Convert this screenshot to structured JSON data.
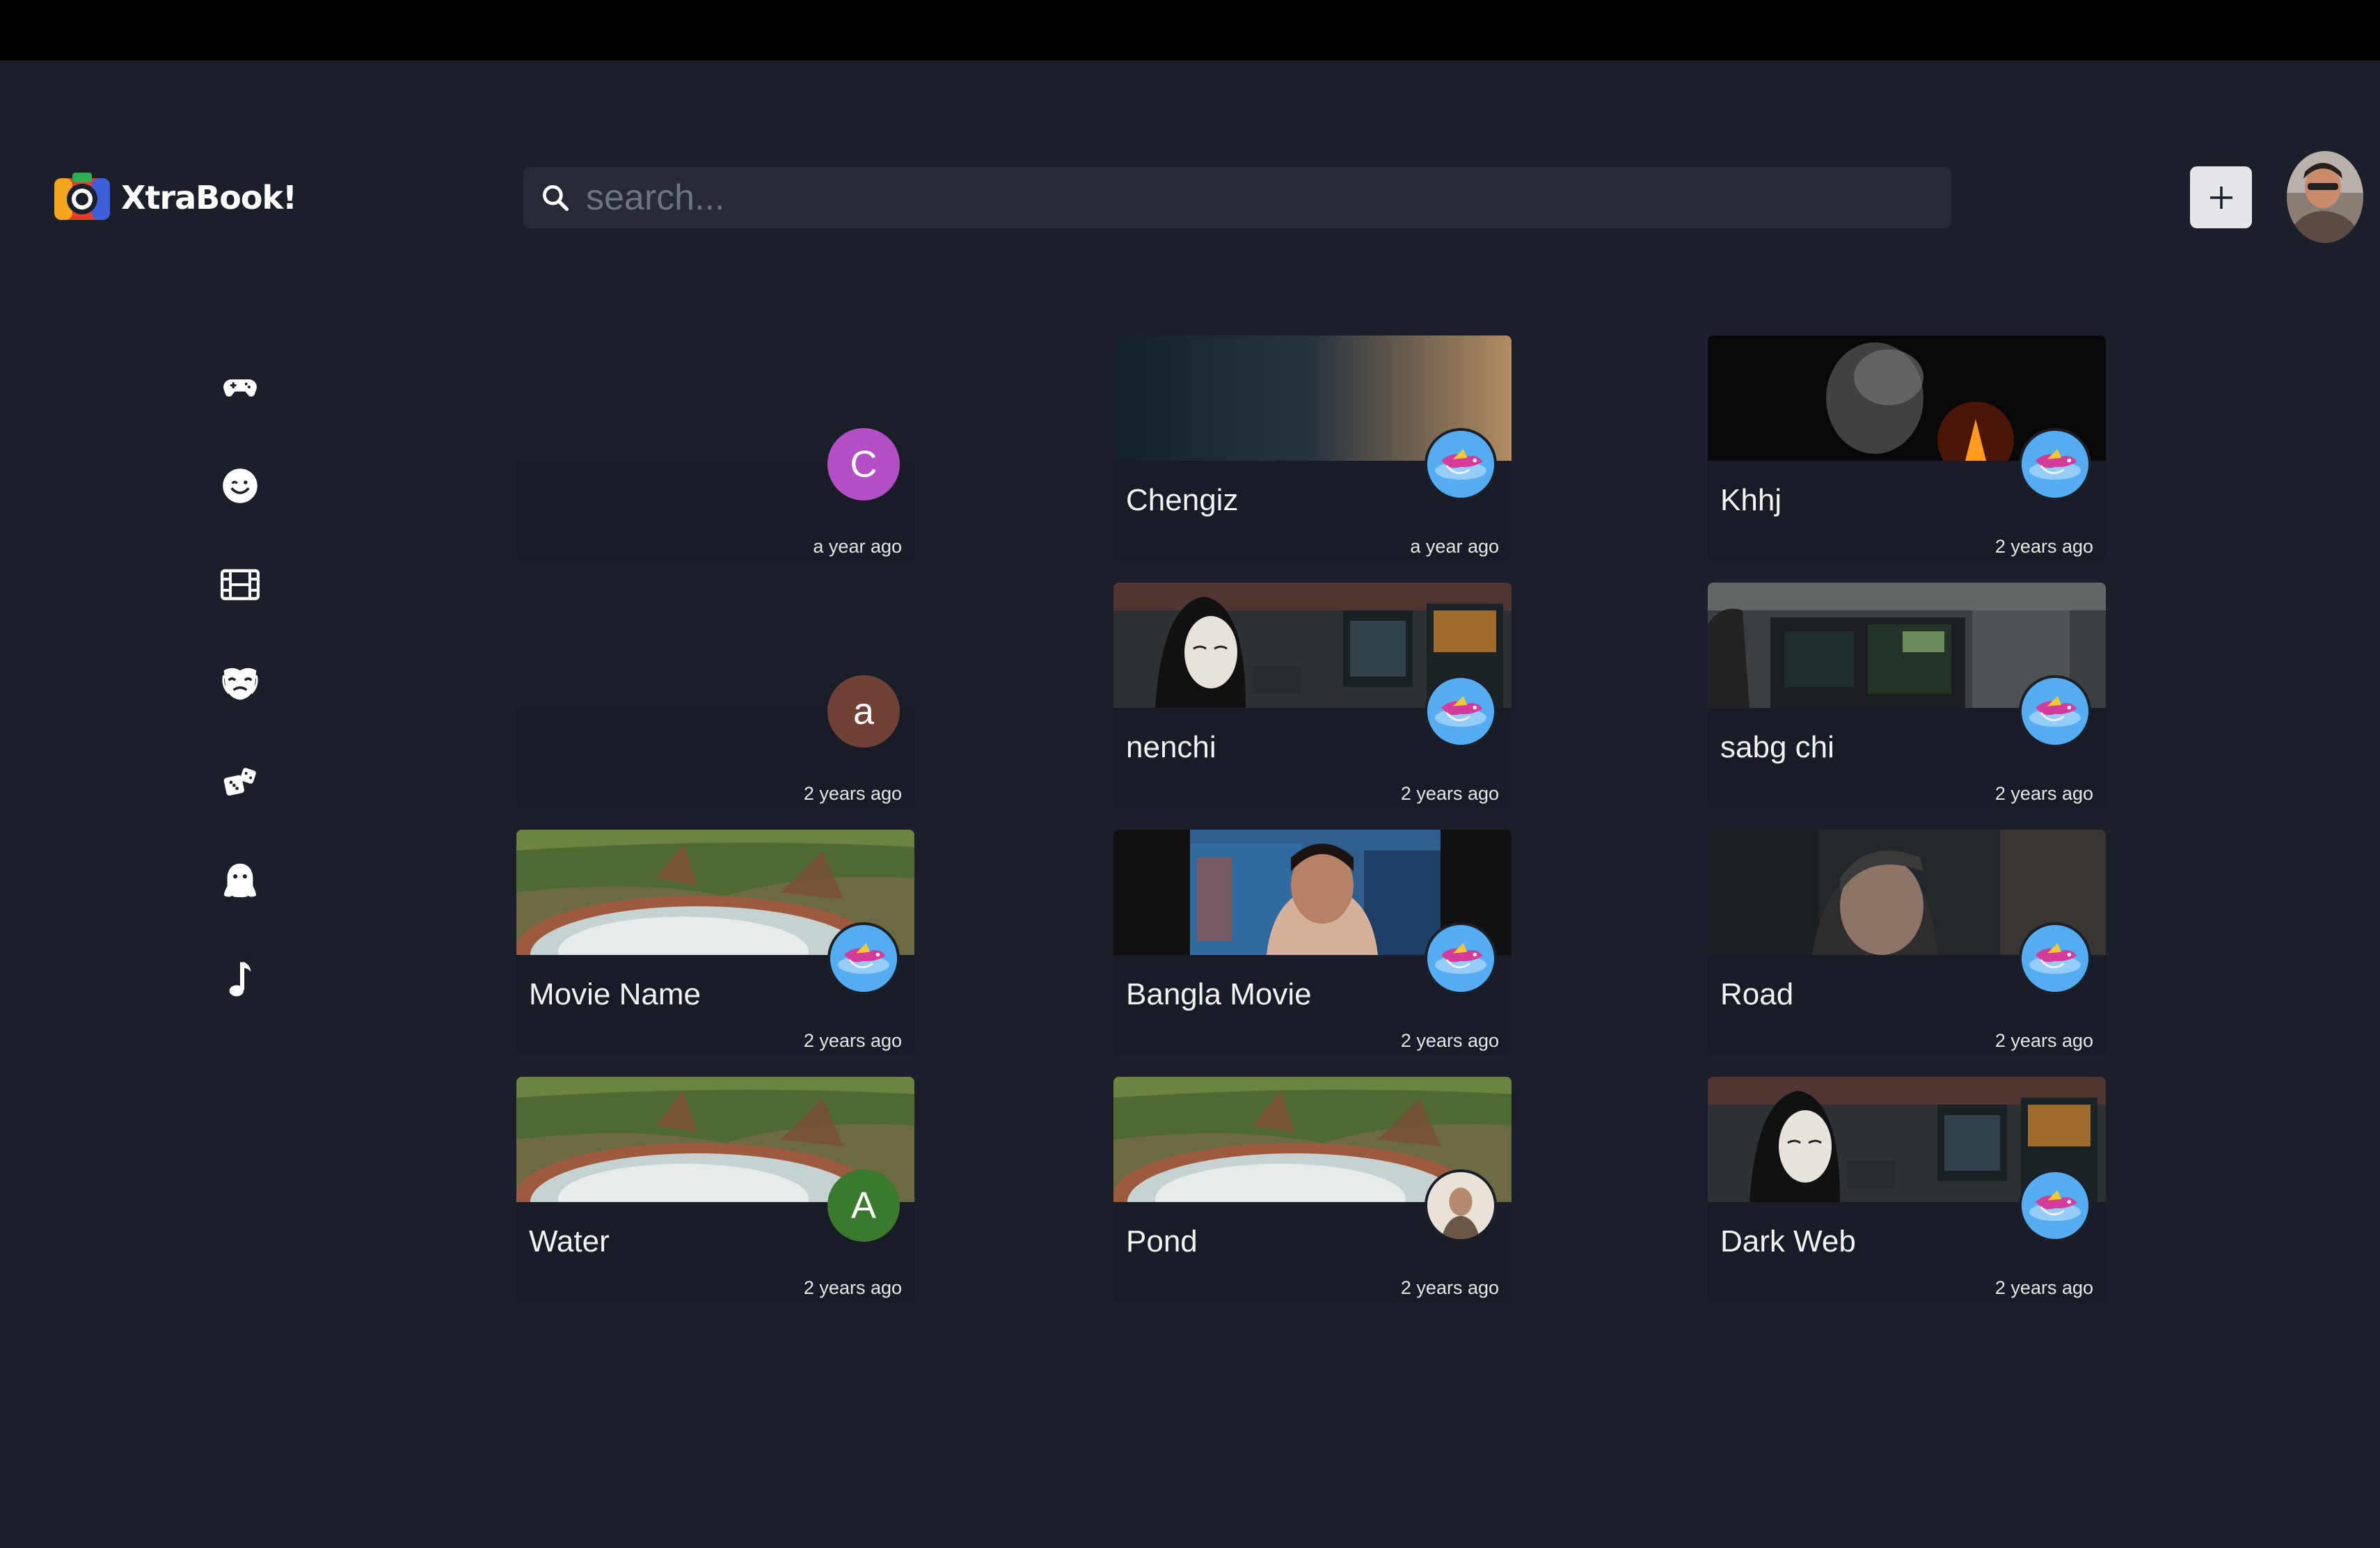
{
  "app": {
    "name": "XtraBook!"
  },
  "search": {
    "placeholder": "search..."
  },
  "header": {
    "add_label": "+"
  },
  "sidebar": {
    "items": [
      {
        "name": "gamepad-icon"
      },
      {
        "name": "smile-icon"
      },
      {
        "name": "film-icon"
      },
      {
        "name": "mask-icon"
      },
      {
        "name": "dice-icon"
      },
      {
        "name": "ghost-icon"
      },
      {
        "name": "music-note-icon"
      }
    ]
  },
  "cards": [
    {
      "title": "",
      "ago": "a year ago",
      "avatar_letter": "C",
      "avatar_color": "#b24fc4",
      "thumb": "empty"
    },
    {
      "title": "Chengiz",
      "ago": "a year ago",
      "avatar_letter": "",
      "avatar_color": "",
      "thumb": "dusk"
    },
    {
      "title": "Khhj",
      "ago": "2 years ago",
      "avatar_letter": "",
      "avatar_color": "",
      "thumb": "fire"
    },
    {
      "title": "",
      "ago": "2 years ago",
      "avatar_letter": "a",
      "avatar_color": "#6e4036",
      "thumb": "empty"
    },
    {
      "title": "nenchi",
      "ago": "2 years ago",
      "avatar_letter": "",
      "avatar_color": "",
      "thumb": "hacker"
    },
    {
      "title": "sabg chi",
      "ago": "2 years ago",
      "avatar_letter": "",
      "avatar_color": "",
      "thumb": "monitors"
    },
    {
      "title": "Movie Name",
      "ago": "2 years ago",
      "avatar_letter": "",
      "avatar_color": "",
      "thumb": "crater"
    },
    {
      "title": "Bangla Movie",
      "ago": "2 years ago",
      "avatar_letter": "",
      "avatar_color": "",
      "thumb": "portrait"
    },
    {
      "title": "Road",
      "ago": "2 years ago",
      "avatar_letter": "",
      "avatar_color": "",
      "thumb": "man"
    },
    {
      "title": "Water",
      "ago": "2 years ago",
      "avatar_letter": "A",
      "avatar_color": "#3a7a2c",
      "thumb": "crater"
    },
    {
      "title": "Pond",
      "ago": "2 years ago",
      "avatar_letter": "",
      "avatar_color": "",
      "thumb": "crater",
      "avatar_photo": true
    },
    {
      "title": "Dark Web",
      "ago": "2 years ago",
      "avatar_letter": "",
      "avatar_color": "",
      "thumb": "hacker"
    }
  ]
}
